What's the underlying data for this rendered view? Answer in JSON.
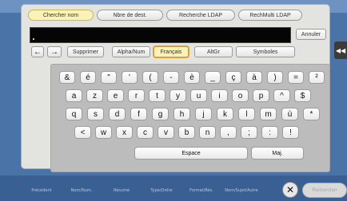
{
  "tabs": [
    {
      "label": "Chercher nom",
      "active": true
    },
    {
      "label": "Nbre de dest.",
      "active": false
    },
    {
      "label": "Recherche LDAP",
      "active": false
    },
    {
      "label": "RechMulti LDAP",
      "active": false
    }
  ],
  "input": {
    "value": ""
  },
  "annuler_label": "Annuler",
  "controls": {
    "left_arrow": "←",
    "right_arrow": "→",
    "supprimer": "Supprimer",
    "alpha_num": "Alpha/Num",
    "francais": "Français",
    "altgr": "AltGr",
    "symboles": "Symboles"
  },
  "side_button": "◀◀",
  "keyboard": {
    "row1": [
      "&",
      "é",
      "\"",
      "'",
      "(",
      "-",
      "è",
      "_",
      "ç",
      "à",
      ")",
      "=",
      "²"
    ],
    "row2": [
      "a",
      "z",
      "e",
      "r",
      "t",
      "y",
      "u",
      "i",
      "o",
      "p",
      "^",
      "$"
    ],
    "row3": [
      "q",
      "s",
      "d",
      "f",
      "g",
      "h",
      "j",
      "k",
      "l",
      "m",
      "ù",
      "*"
    ],
    "row4": [
      "<",
      "w",
      "x",
      "c",
      "v",
      "b",
      "n",
      ",",
      ";",
      ":",
      "!"
    ],
    "space": "Espace",
    "shift": "Maj."
  },
  "background_tabs": [
    "Précédent",
    "Nom/Num.",
    "Résumé",
    "Type/Ordre",
    "Format/Rés.",
    "Nom/Sujet/Autre"
  ],
  "close_symbol": "✕",
  "ok_label": "Rechercher"
}
